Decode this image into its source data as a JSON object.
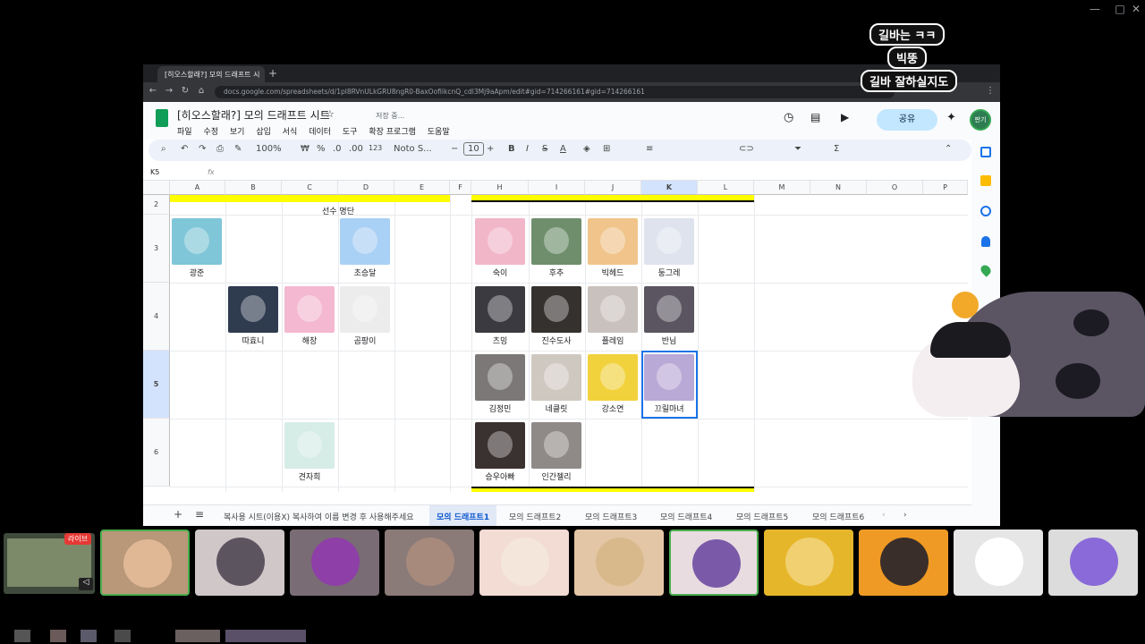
{
  "window": {
    "controls": [
      "—",
      "□",
      "✕"
    ]
  },
  "overlay": {
    "lines": [
      "길바는 ㅋㅋ",
      "빅뚱",
      "길바 잘하실지도"
    ]
  },
  "browser": {
    "tab_title": "[히오스할래?] 모의 드래프트 시",
    "url": "docs.google.com/spreadsheets/d/1pl8RVnULkGRU8ngR0-BaxOofiikcnQ_cdl3Mj9aApm/edit#gid=714266161#gid=714266161"
  },
  "sheets": {
    "title": "[히오스할래?] 모의 드래프트 시트",
    "saving": "저장 중...",
    "menu": [
      "파일",
      "수정",
      "보기",
      "삽입",
      "서식",
      "데이터",
      "도구",
      "확장 프로그램",
      "도움말"
    ],
    "share_label": "공유",
    "account_label": "판기",
    "toolbar": {
      "zoom": "100%",
      "currency": "₩",
      "percent": "%",
      "dec_less": ".0",
      "dec_more": ".00",
      "num_fmt": "123",
      "font": "Noto S...",
      "font_size": "10"
    },
    "cell_ref": "K5",
    "fx": "fx",
    "columns_left": [
      "A",
      "B",
      "C",
      "D",
      "E",
      "F"
    ],
    "columns_right": [
      "H",
      "I",
      "J",
      "K",
      "L",
      "M",
      "N",
      "O",
      "P"
    ],
    "rows": [
      "2",
      "3",
      "4",
      "5",
      "6"
    ],
    "list_title": "선수 명단",
    "left_players": [
      {
        "name": "광준",
        "color": "#7fc6d8",
        "icon": "avatar-icon"
      },
      {
        "name": "초승달",
        "color": "#a9d0f5",
        "icon": "avatar-icon"
      },
      {
        "name": "따효니",
        "color": "#2f3b4f",
        "icon": "avatar-icon"
      },
      {
        "name": "해장",
        "color": "#f4b8d0",
        "icon": "avatar-icon"
      },
      {
        "name": "곰팡이",
        "color": "#ececec",
        "icon": "avatar-icon"
      },
      {
        "name": "견자희",
        "color": "#d6ece7",
        "icon": "avatar-icon"
      }
    ],
    "right_players": [
      {
        "name": "숙이",
        "color": "#f2b6c9",
        "icon": "avatar-icon"
      },
      {
        "name": "후추",
        "color": "#6f8f6c",
        "icon": "avatar-icon"
      },
      {
        "name": "빅헤드",
        "color": "#f0c48a",
        "icon": "avatar-icon"
      },
      {
        "name": "둥그레",
        "color": "#dfe3ee",
        "icon": "avatar-icon"
      },
      {
        "name": "츠밍",
        "color": "#3b3a40",
        "icon": "avatar-icon"
      },
      {
        "name": "진수도사",
        "color": "#35312e",
        "icon": "avatar-icon"
      },
      {
        "name": "플레임",
        "color": "#c9c1bd",
        "icon": "avatar-icon"
      },
      {
        "name": "반님",
        "color": "#5a5560",
        "icon": "avatar-icon"
      },
      {
        "name": "김정민",
        "color": "#7d7878",
        "icon": "avatar-icon"
      },
      {
        "name": "네클릿",
        "color": "#cfc8c0",
        "icon": "avatar-icon"
      },
      {
        "name": "강소연",
        "color": "#f2d23c",
        "icon": "avatar-icon"
      },
      {
        "name": "끄릴마녀",
        "color": "#b9a9d6",
        "icon": "avatar-icon"
      },
      {
        "name": "승우아빠",
        "color": "#3a3230",
        "icon": "avatar-icon"
      },
      {
        "name": "인간젤리",
        "color": "#8f8a88",
        "icon": "avatar-icon"
      }
    ],
    "sheet_tabs": [
      "복사용 시트(이용X) 복사하여 이름 변경 후 사용해주세요",
      "모의 드래프트1",
      "모의 드래프트2",
      "모의 드래프트3",
      "모의 드래프트4",
      "모의 드래프트5",
      "모의 드래프트6"
    ],
    "active_tab": "모의 드래프트1",
    "highlight_color": "#ffff00"
  },
  "participants": {
    "live_badge": "라이브",
    "tiles": [
      {
        "bg": "#b89878",
        "av": "#e0b896",
        "icon": "avatar-icon"
      },
      {
        "bg": "#cfc7c8",
        "av": "#5c5560",
        "icon": "avatar-icon"
      },
      {
        "bg": "#7a6c74",
        "av": "#8e3fa8",
        "icon": "avatar-icon"
      },
      {
        "bg": "#8a7a78",
        "av": "#a88a7c",
        "icon": "avatar-icon"
      },
      {
        "bg": "#f2dcd3",
        "av": "#f5e6dc",
        "icon": "avatar-icon"
      },
      {
        "bg": "#e3c6a5",
        "av": "#d8b98c",
        "icon": "avatar-icon"
      },
      {
        "bg": "#e9dce0",
        "av": "#7a5aa8",
        "icon": "avatar-icon"
      },
      {
        "bg": "#e6b62a",
        "av": "#f0d070",
        "icon": "avatar-icon"
      },
      {
        "bg": "#ef9a24",
        "av": "#3a2e2a",
        "icon": "avatar-icon"
      },
      {
        "bg": "#e6e6e6",
        "av": "#ffffff",
        "icon": "avatar-icon"
      },
      {
        "bg": "#dcdcdc",
        "av": "#8a6ad8",
        "icon": "avatar-icon"
      }
    ]
  }
}
